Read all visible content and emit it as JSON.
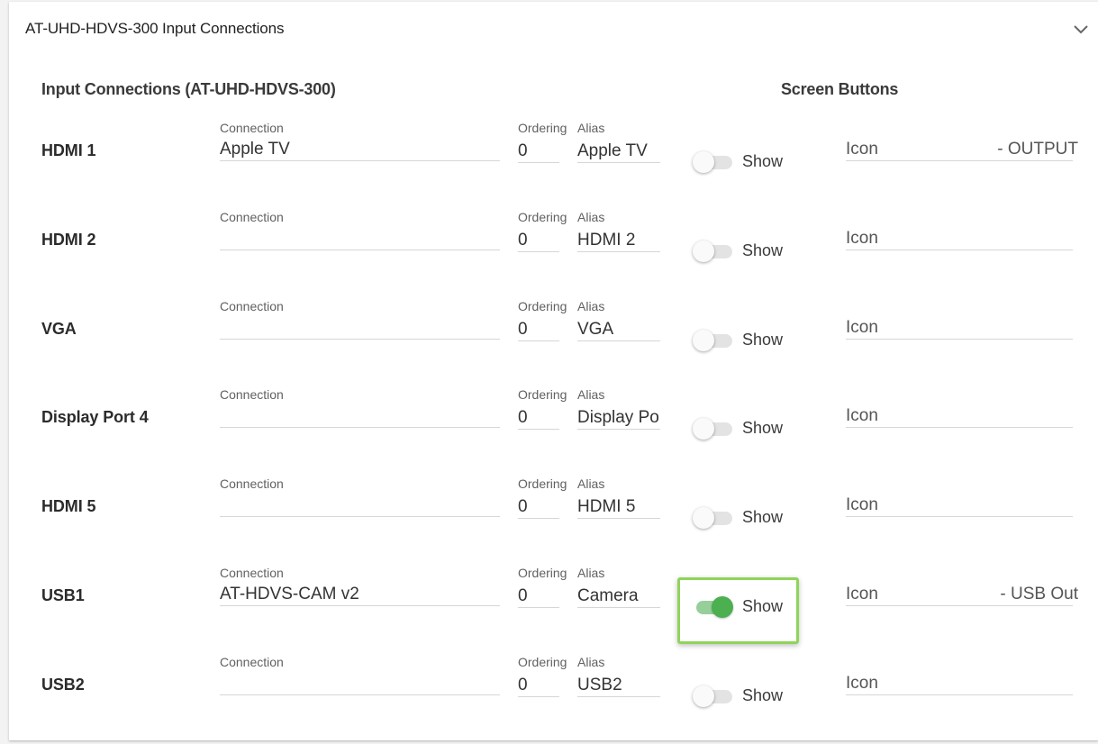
{
  "panel": {
    "title": "AT-UHD-HDVS-300 Input Connections"
  },
  "sections": {
    "input_connections_title": "Input Connections (AT-UHD-HDVS-300)",
    "screen_buttons_title": "Screen Buttons"
  },
  "labels": {
    "connection": "Connection",
    "ordering": "Ordering",
    "alias": "Alias",
    "show": "Show",
    "icon": "Icon"
  },
  "rows": [
    {
      "name": "HDMI 1",
      "connection": "Apple TV",
      "ordering": "0",
      "alias": "Apple TV",
      "show": false,
      "icon_text": "- OUTPUT"
    },
    {
      "name": "HDMI 2",
      "connection": "",
      "ordering": "0",
      "alias": "HDMI 2",
      "show": false,
      "icon_text": ""
    },
    {
      "name": "VGA",
      "connection": "",
      "ordering": "0",
      "alias": "VGA",
      "show": false,
      "icon_text": ""
    },
    {
      "name": "Display Port 4",
      "connection": "",
      "ordering": "0",
      "alias": "Display Po",
      "show": false,
      "icon_text": ""
    },
    {
      "name": "HDMI 5",
      "connection": "",
      "ordering": "0",
      "alias": "HDMI 5",
      "show": false,
      "icon_text": ""
    },
    {
      "name": "USB1",
      "connection": "AT-HDVS-CAM v2",
      "ordering": "0",
      "alias": "Camera",
      "show": true,
      "icon_text": "- USB Out"
    },
    {
      "name": "USB2",
      "connection": "",
      "ordering": "0",
      "alias": "USB2",
      "show": false,
      "icon_text": ""
    }
  ],
  "colors": {
    "toggle_on": "#4caf50",
    "highlight": "#8fd45a"
  }
}
